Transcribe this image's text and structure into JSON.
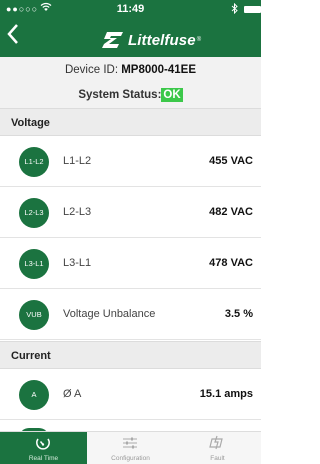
{
  "status_bar": {
    "signal": "●●○○○",
    "time": "11:49"
  },
  "header": {
    "brand": "Littelfuse",
    "brand_mark": "®",
    "back_icon": "chevron-left-icon"
  },
  "device": {
    "label": "Device ID:",
    "id": "MP8000-41EE"
  },
  "system_status": {
    "label": "System Status:",
    "value": "OK",
    "ok_color": "#3cc84a"
  },
  "sections": {
    "voltage": {
      "title": "Voltage",
      "rows": [
        {
          "icon": "L1-L2",
          "label": "L1-L2",
          "value": "455 VAC"
        },
        {
          "icon": "L2-L3",
          "label": "L2-L3",
          "value": "482 VAC"
        },
        {
          "icon": "L3-L1",
          "label": "L3-L1",
          "value": "478 VAC"
        },
        {
          "icon": "VUB",
          "label": "Voltage Unbalance",
          "value": "3.5 %"
        }
      ]
    },
    "current": {
      "title": "Current",
      "rows": [
        {
          "icon": "A",
          "label": "Ø A",
          "value": "15.1 amps"
        }
      ]
    }
  },
  "tabs": [
    {
      "label": "Real Time",
      "icon": "gauge-icon",
      "active": true
    },
    {
      "label": "Configuration",
      "icon": "sliders-icon",
      "active": false
    },
    {
      "label": "Fault",
      "icon": "fault-icon",
      "active": false
    }
  ],
  "colors": {
    "brand_green": "#1b7340",
    "section_bg": "#ececec"
  }
}
